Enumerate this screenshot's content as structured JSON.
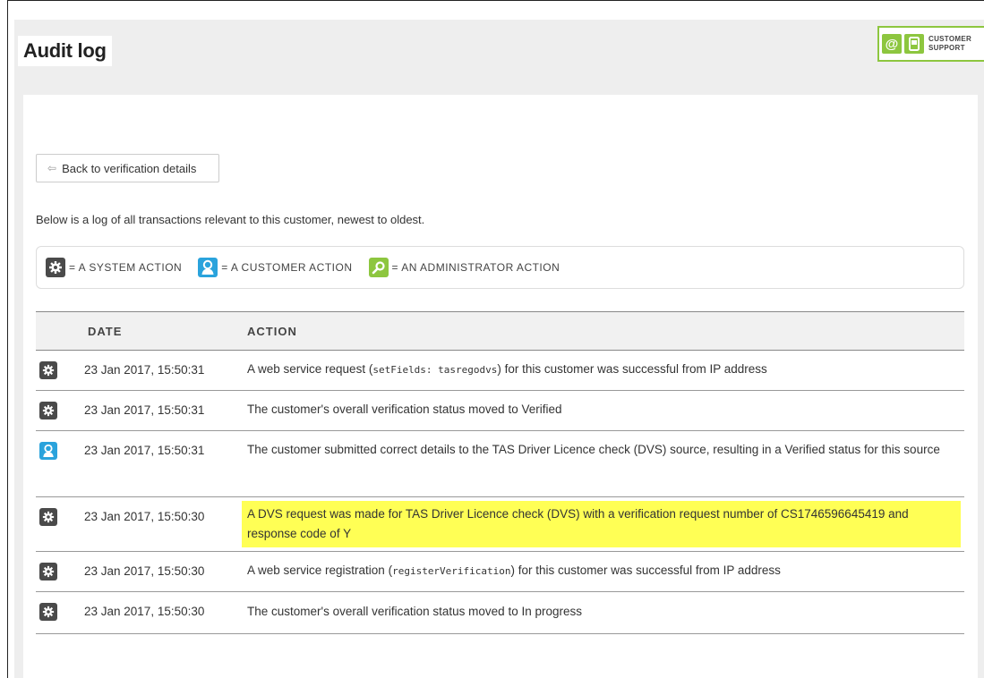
{
  "page": {
    "title": "Audit log"
  },
  "support_badge": {
    "line1": "CUSTOMER",
    "line2": "SUPPORT",
    "email_icon": "at-icon",
    "phone_icon": "phone-icon",
    "accent_color": "#8dc63f"
  },
  "back_button": {
    "label": "Back to verification details",
    "icon": "arrow-left-icon"
  },
  "intro_text": "Below is a log of all transactions relevant to this customer, newest to oldest.",
  "legend": {
    "system": "= A SYSTEM ACTION",
    "customer": "= A CUSTOMER ACTION",
    "administrator": "= AN ADMINISTRATOR ACTION"
  },
  "table": {
    "headers": {
      "date": "DATE",
      "action": "ACTION"
    },
    "rows": [
      {
        "type": "system",
        "date": "23 Jan 2017, 15:50:31",
        "pre": "A web service request (",
        "code": "setFields: tasregodvs",
        "post": ") for this customer was successful from IP address"
      },
      {
        "type": "system",
        "date": "23 Jan 2017, 15:50:31",
        "text": "The customer's overall verification status moved to Verified"
      },
      {
        "type": "customer",
        "date": "23 Jan 2017, 15:50:31",
        "text": "The customer submitted correct details to the TAS Driver Licence check (DVS) source, resulting in a Verified status for this source"
      },
      {
        "type": "system",
        "date": "23 Jan 2017, 15:50:30",
        "text": "A DVS request was made for TAS Driver Licence check (DVS) with a verification request number of CS1746596645419 and response code of Y",
        "highlight": "#ffff55"
      },
      {
        "type": "system",
        "date": "23 Jan 2017, 15:50:30",
        "pre": "A web service registration (",
        "code": "registerVerification",
        "post": ") for this customer was successful from IP address"
      },
      {
        "type": "system",
        "date": "23 Jan 2017, 15:50:30",
        "text": "The customer's overall verification status moved to In progress"
      }
    ]
  }
}
